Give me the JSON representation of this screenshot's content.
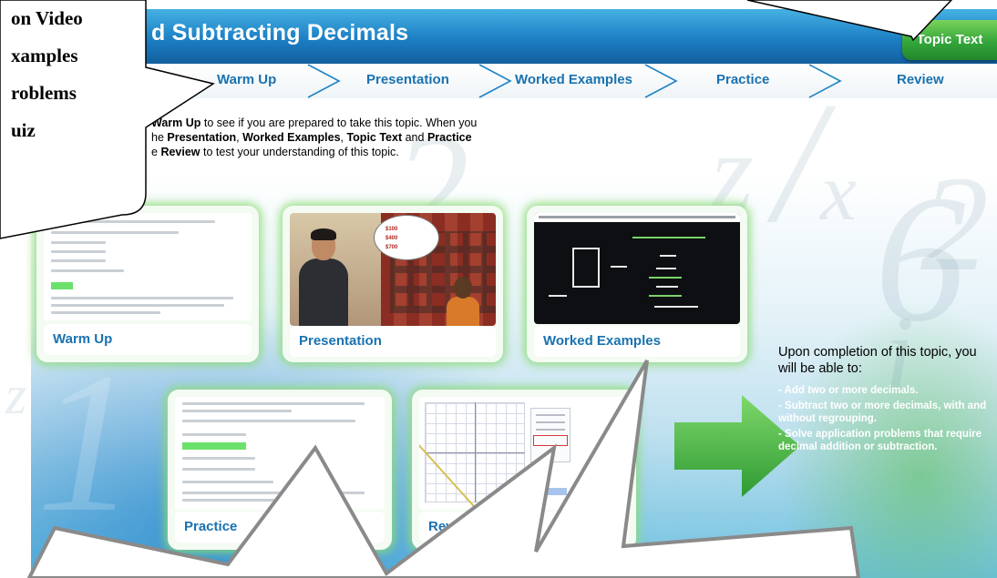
{
  "header": {
    "title": "d Subtracting Decimals",
    "topic_text_button": "Topic Text"
  },
  "nav": {
    "items": [
      {
        "label": "Warm Up"
      },
      {
        "label": "Presentation"
      },
      {
        "label": "Worked Examples"
      },
      {
        "label": "Practice"
      },
      {
        "label": "Review"
      }
    ]
  },
  "intro": {
    "line1": {
      "pre": "",
      "b1": "Warm Up",
      "post": " to see if you are prepared to take this topic. When you"
    },
    "line2": {
      "pre": "he ",
      "b1": "Presentation",
      "mid1": ", ",
      "b2": "Worked Examples",
      "mid2": ", ",
      "b3": "Topic Text",
      "mid3": " and ",
      "b4": "Practice"
    },
    "line3": {
      "pre": "e ",
      "b1": "Review",
      "post": " to test your understanding of this topic."
    }
  },
  "cards": {
    "warm_up": "Warm Up",
    "presentation": "Presentation",
    "worked_examples": "Worked Examples",
    "practice": "Practice",
    "review": "Review"
  },
  "outcomes": {
    "title": "Upon completion of this topic, you will be able to:",
    "items": [
      "- Add two or more decimals.",
      "- Subtract two or more decimals, with and without regrouping.",
      "- Solve application problems that require decimal addition or subtraction."
    ]
  },
  "callout_left": {
    "lines": [
      "on Video",
      "xamples",
      "roblems",
      "uiz"
    ]
  },
  "colors": {
    "header_blue": "#1c7fc4",
    "nav_text": "#1a72b0",
    "topic_green": "#33a63a",
    "card_glow": "#8cdc78",
    "outcome_text": "#ffffff"
  },
  "icons": {
    "nav_separator": "chevron-right-icon",
    "start_arrow": "arrow-right-icon"
  }
}
